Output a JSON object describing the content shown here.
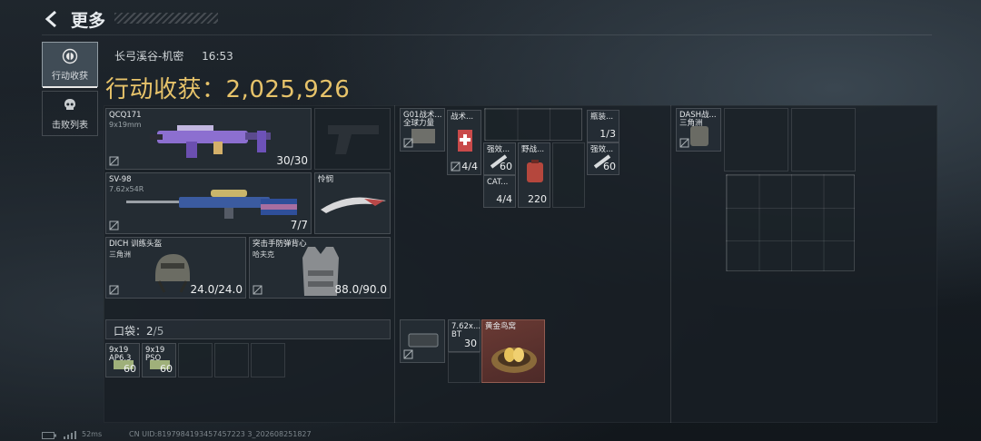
{
  "header": {
    "title": "更多"
  },
  "tabs": [
    {
      "label": "行动收获",
      "icon": "target-icon",
      "active": true
    },
    {
      "label": "击败列表",
      "icon": "skull-icon",
      "active": false
    }
  ],
  "raid": {
    "map": "长弓溪谷-机密",
    "time": "16:53",
    "haul_label": "行动收获：",
    "haul_value": "2,025,926"
  },
  "gear": {
    "primary": {
      "name": "QCQ171",
      "ammo": "9x19mm",
      "count": "30/30"
    },
    "secondary": {
      "name": "SV-98",
      "ammo": "7.62x54R",
      "count": "7/7"
    },
    "melee": {
      "name": "怜悯"
    },
    "helmet": {
      "name": "DICH 训练头盔",
      "sub": "三角洲",
      "durability": "24.0/24.0"
    },
    "armor": {
      "name": "突击手防弹背心",
      "sub": "哈夫克",
      "durability": "88.0/90.0"
    }
  },
  "pocket": {
    "label": "口袋：",
    "used": "2",
    "max": "/5",
    "items": [
      {
        "name": "9x19",
        "sub": "AP6.3",
        "count": "60"
      },
      {
        "name": "9x19",
        "sub": "PSO",
        "count": "60"
      }
    ]
  },
  "chest_rig": {
    "name": "G01战术...",
    "sub": "全球力量",
    "items": [
      {
        "name": "战术...",
        "count": "4/4"
      },
      {
        "name": "强效...",
        "count": "60"
      },
      {
        "name": "野战...",
        "count": "220"
      },
      {
        "name": "CAT...",
        "count": "4/4"
      },
      {
        "name": "瓶装...",
        "count": "1/3"
      },
      {
        "name": "强效...",
        "count": "60"
      },
      {
        "name": "7.62x...",
        "sub": "BT",
        "count": "30"
      },
      {
        "name": "黄金鸟窝",
        "count": ""
      }
    ]
  },
  "backpack": {
    "name": "DASH战...",
    "sub": "三角洲"
  },
  "footer": {
    "ping": "52ms",
    "uid": "CN UID:8197984193457457223 3_202608251827"
  },
  "colors": {
    "accent_gold": "#e7c36a",
    "gold_item_bg": "#6a3a34",
    "panel_bg": "#181f25"
  }
}
